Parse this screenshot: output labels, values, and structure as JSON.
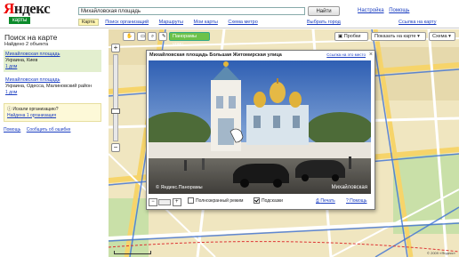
{
  "header": {
    "logo_word": "Яндекс",
    "logo_sub": "карты",
    "search_value": "Михайловская площадь",
    "find_label": "Найти",
    "tools": [
      "Настройка",
      "Помощь"
    ],
    "map_link": "Ссылка на карту"
  },
  "tabs": [
    "Карта",
    "Поиск организаций",
    "Маршруты",
    "Мои карты",
    "Схема метро"
  ],
  "extra_link": "Выбрать город",
  "left": {
    "title": "Поиск на карте",
    "found": "Найдено 2 объекта",
    "results": [
      {
        "name": "Михайловская площадь",
        "address": "Украина, Киев",
        "extra": "1 дом"
      },
      {
        "name": "Михайловская площадь",
        "address": "Украина, Одесса, Малиновский район",
        "extra": "1 дом"
      }
    ],
    "org_question": "Искали организацию?",
    "org_link": "Найдена 1 организация",
    "bottom_links": [
      "Помощь",
      "Сообщить об ошибке"
    ]
  },
  "map": {
    "highlight_button": "Панорамы улиц",
    "panorama_button": "Пробки",
    "show_on_map": "Показать на карте",
    "layer_button": "Схема",
    "copyright": "© 2009 «Яндекс»"
  },
  "popup": {
    "title": "Михайловская площадь Большая Житомирская улица",
    "link": "Ссылка на это место",
    "close": "×",
    "photo_mark": "© Яндекс.Панорамы",
    "photo_credit": "Михайловская",
    "fullscreen": "Полноэкранный режим",
    "hints": "Подсказки",
    "print": "Печать",
    "help": "Помощь"
  },
  "colors": {
    "accent": "#0b8a2a",
    "link": "#1a3dc1",
    "brand_red": "#e00000"
  }
}
